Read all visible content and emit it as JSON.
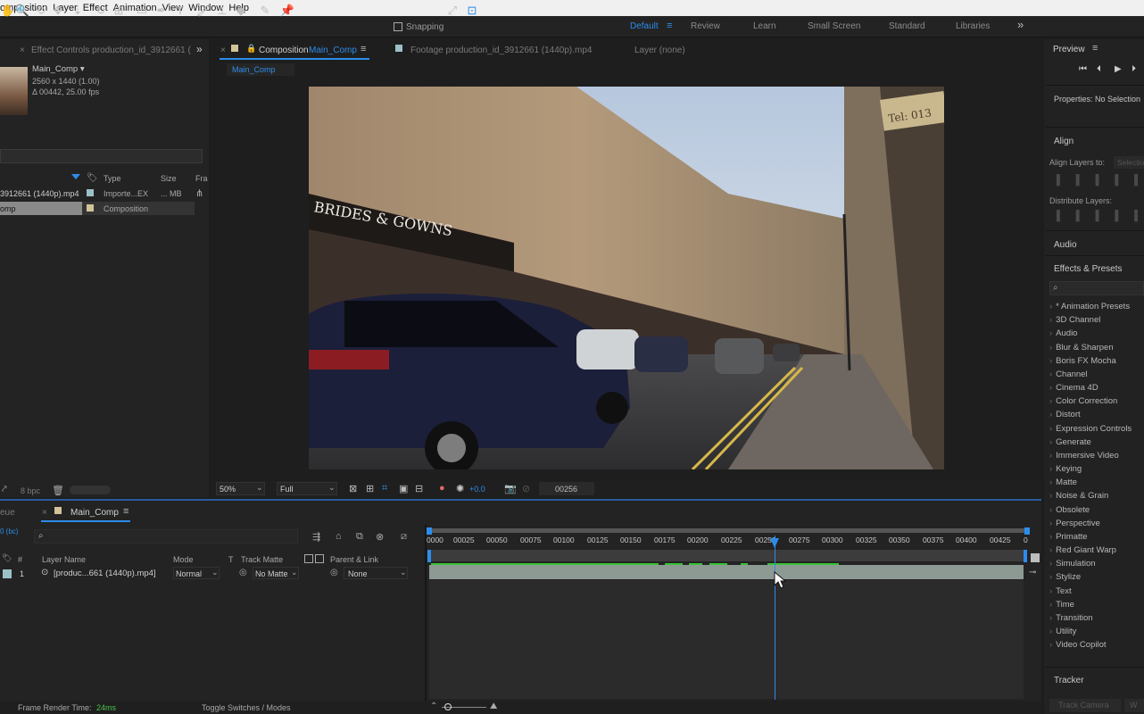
{
  "menu": [
    "omposition",
    "Layer",
    "Effect",
    "Animation",
    "View",
    "Window",
    "Help"
  ],
  "toolbar": {
    "snapping": "Snapping"
  },
  "workspaces": {
    "items": [
      "Default",
      "Review",
      "Learn",
      "Small Screen",
      "Standard",
      "Libraries"
    ],
    "active": "Default",
    "more": "»"
  },
  "project": {
    "tab": "Effect Controls production_id_3912661 (",
    "more": "»",
    "comp_name": "Main_Comp ▾",
    "comp_size": "2560 x 1440 (1.00)",
    "comp_duration": "Δ 00442, 25.00 fps",
    "headers": {
      "type": "Type",
      "size": "Size",
      "fra": "Fra"
    },
    "rows": [
      {
        "name": "3912661 (1440p).mp4",
        "type": "Importe...EX",
        "size": "... MB"
      },
      {
        "name": "omp",
        "type": "Composition",
        "size": ""
      }
    ],
    "bpc": "8 bpc"
  },
  "comp_panel": {
    "tab_label": "Composition",
    "tab_comp": "Main_Comp",
    "footage_tab": "Footage production_id_3912661 (1440p).mp4",
    "layer_tab": "Layer (none)",
    "breadcrumb": "Main_Comp",
    "zoom": "50%",
    "resolution": "Full",
    "exposure": "+0.0",
    "timecode": "00256",
    "sign_text": "BRIDES & GOWNS",
    "sign2_text": "Tel: 013"
  },
  "timeline": {
    "queue_tab": "eue",
    "comp_tab": "Main_Comp",
    "fps_frag": "0 (bc)",
    "headers": {
      "num": "#",
      "layer_name": "Layer Name",
      "mode": "Mode",
      "t": "T",
      "track_matte": "Track Matte",
      "parent": "Parent & Link"
    },
    "layer": {
      "index": "1",
      "name": "[produc...661 (1440p).mp4]",
      "mode": "Normal",
      "matte": "No Matte",
      "parent": "None"
    },
    "ticks": [
      "0000",
      "00025",
      "00050",
      "00075",
      "00100",
      "00125",
      "00150",
      "00175",
      "00200",
      "00225",
      "00250",
      "00275",
      "00300",
      "00325",
      "00350",
      "00375",
      "00400",
      "00425",
      "0"
    ],
    "footer_render_label": "Frame Render Time:",
    "footer_render_value": "24ms",
    "footer_toggle": "Toggle Switches / Modes"
  },
  "right_panel": {
    "preview": "Preview",
    "properties": "Properties: No Selection",
    "align": "Align",
    "align_layers_to": "Align Layers to:",
    "align_select": "Selectio",
    "distribute": "Distribute Layers:",
    "audio": "Audio",
    "effects_presets": "Effects & Presets",
    "effects_list": [
      "* Animation Presets",
      "3D Channel",
      "Audio",
      "Blur & Sharpen",
      "Boris FX Mocha",
      "Channel",
      "Cinema 4D",
      "Color Correction",
      "Distort",
      "Expression Controls",
      "Generate",
      "Immersive Video",
      "Keying",
      "Matte",
      "Noise & Grain",
      "Obsolete",
      "Perspective",
      "Primatte",
      "Red Giant Warp",
      "Simulation",
      "Stylize",
      "Text",
      "Time",
      "Transition",
      "Utility",
      "Video Copilot"
    ],
    "tracker": "Tracker",
    "track_camera": "Track Camera",
    "warp": "W"
  },
  "colors": {
    "accent": "#2d8ceb",
    "panel": "#232323",
    "bg": "#1d1d1d",
    "green": "#36c236"
  }
}
